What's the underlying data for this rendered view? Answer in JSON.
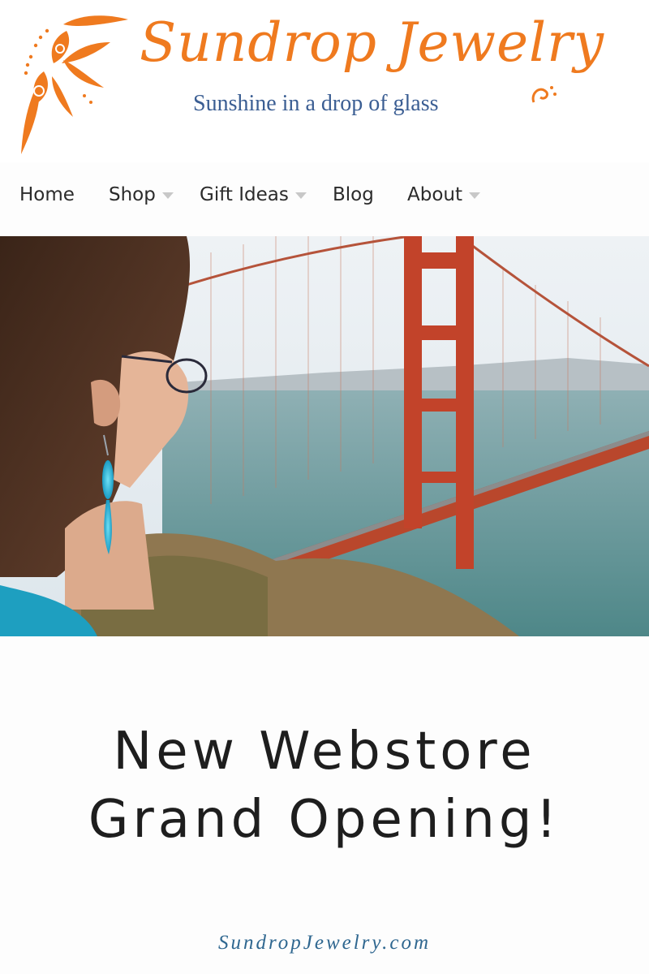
{
  "brand": {
    "name": "Sundrop Jewelry",
    "tagline": "Sunshine in a drop of glass",
    "logo_icon": "sun-drop-icon",
    "colors": {
      "orange": "#ef7a1f",
      "blue": "#3b5e93"
    }
  },
  "nav": {
    "items": [
      {
        "label": "Home",
        "has_dropdown": false
      },
      {
        "label": "Shop",
        "has_dropdown": true
      },
      {
        "label": "Gift Ideas",
        "has_dropdown": true
      },
      {
        "label": "Blog",
        "has_dropdown": false
      },
      {
        "label": "About",
        "has_dropdown": true
      }
    ]
  },
  "hero": {
    "image": "woman-with-blue-glass-earring-overlooking-golden-gate-bridge"
  },
  "promo": {
    "line1": "New Webstore",
    "line2": "Grand Opening!"
  },
  "footer": {
    "url": "SundropJewelry.com"
  }
}
